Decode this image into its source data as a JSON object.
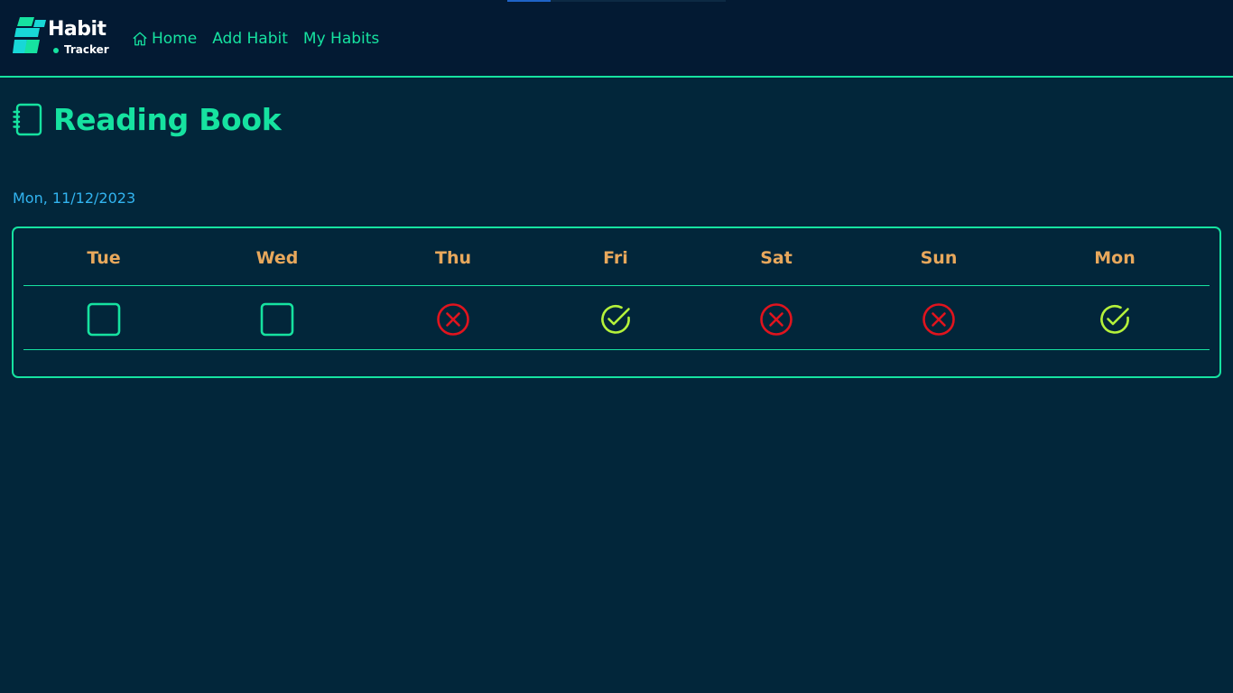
{
  "brand": {
    "title": "Habit",
    "subtitle": "Tracker",
    "mark_color": "#16e2a0",
    "mark_color_secondary": "#18d7d7"
  },
  "nav": {
    "items": [
      {
        "label": "Home",
        "icon": "home-icon"
      },
      {
        "label": "Add Habit"
      },
      {
        "label": "My Habits"
      }
    ]
  },
  "loading_progress": 0.2,
  "habit": {
    "title": "Reading Book",
    "icon": "notebook-icon",
    "date": "Mon, 11/12/2023"
  },
  "week": [
    {
      "day": "Tue",
      "status": "none"
    },
    {
      "day": "Wed",
      "status": "none"
    },
    {
      "day": "Thu",
      "status": "not-done"
    },
    {
      "day": "Fri",
      "status": "done"
    },
    {
      "day": "Sat",
      "status": "not-done"
    },
    {
      "day": "Sun",
      "status": "not-done"
    },
    {
      "day": "Mon",
      "status": "done"
    }
  ],
  "colors": {
    "accent": "#16e2a0",
    "date_text": "#32b4f0",
    "day_text": "#e8a85c",
    "done": "#b5f23a",
    "not_done": "#e0141e",
    "background": "#02263a",
    "header_background": "#031a33"
  }
}
